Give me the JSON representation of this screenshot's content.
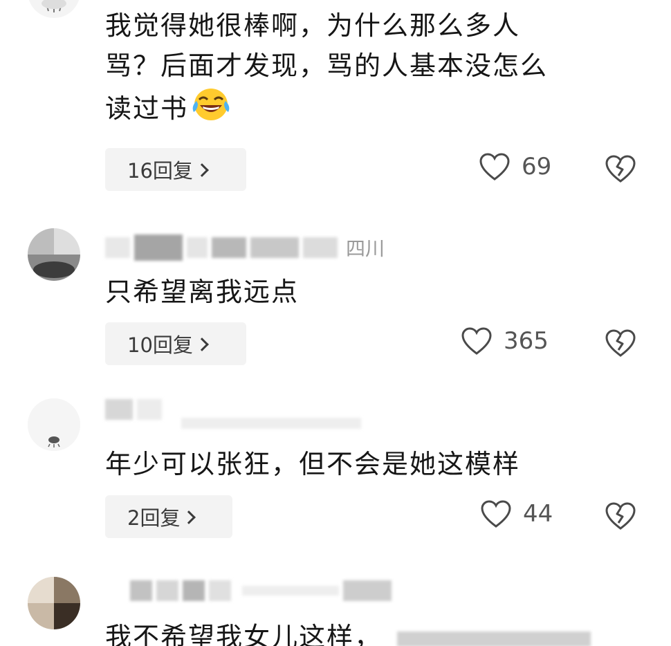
{
  "comments": [
    {
      "text_lines": [
        "我觉得她很棒啊，为什么那么多人",
        "骂？后面才发现，骂的人基本没怎么",
        "读过书"
      ],
      "emoji": "laughing-tears-emoji",
      "replies": "16回复",
      "likes": "69"
    },
    {
      "location": "四川",
      "text_lines": [
        "只希望离我远点"
      ],
      "replies": "10回复",
      "likes": "365"
    },
    {
      "text_lines": [
        "年少可以张狂，但不会是她这模样"
      ],
      "replies": "2回复",
      "likes": "44"
    },
    {
      "text_lines": [
        "我不希望我女儿这样，"
      ]
    }
  ],
  "icons": {
    "like": "heart-outline-icon",
    "dislike": "broken-heart-icon",
    "reply_chevron": "chevron-right-icon"
  },
  "colors": {
    "text": "#161616",
    "muted": "#9a9a9a",
    "pill_bg": "#f3f3f3"
  }
}
